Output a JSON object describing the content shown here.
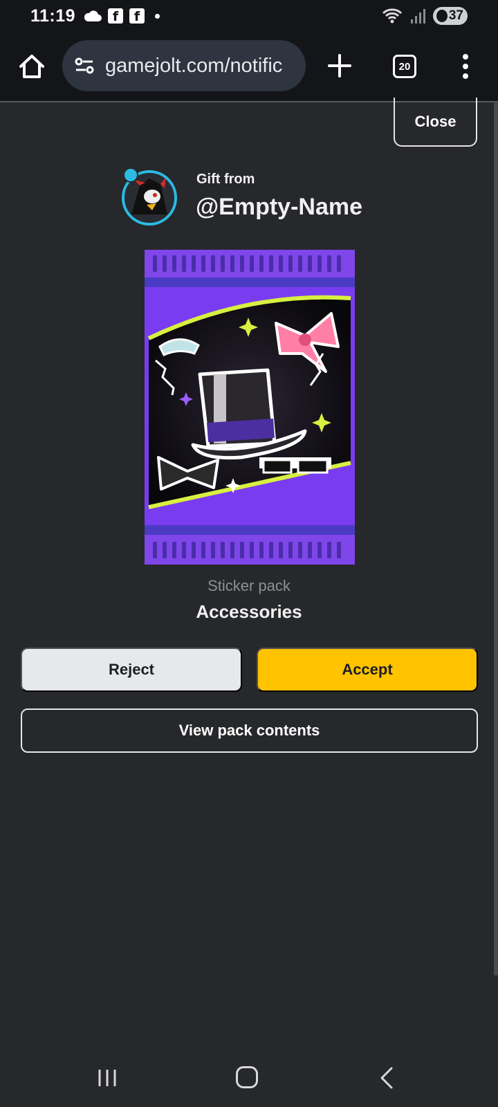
{
  "status_bar": {
    "time": "11:19",
    "left_icons": [
      "cloud-icon",
      "facebook-icon",
      "facebook-icon",
      "dot-icon"
    ],
    "fb_glyph": "f",
    "right_icons": [
      "wifi-icon",
      "signal-icon"
    ],
    "battery": "37"
  },
  "browser": {
    "url": "gamejolt.com/notific",
    "tab_count": "20"
  },
  "dialog": {
    "close_label": "Close",
    "gift_from_label": "Gift from",
    "username": "@Empty-Name",
    "pack_type": "Sticker pack",
    "pack_name": "Accessories",
    "reject_label": "Reject",
    "accept_label": "Accept",
    "view_label": "View pack contents"
  },
  "colors": {
    "background": "#27282b",
    "accent_accept": "#ffc300",
    "avatar_ring": "#2bbbe3",
    "pack_purple": "#7a3cf0"
  }
}
